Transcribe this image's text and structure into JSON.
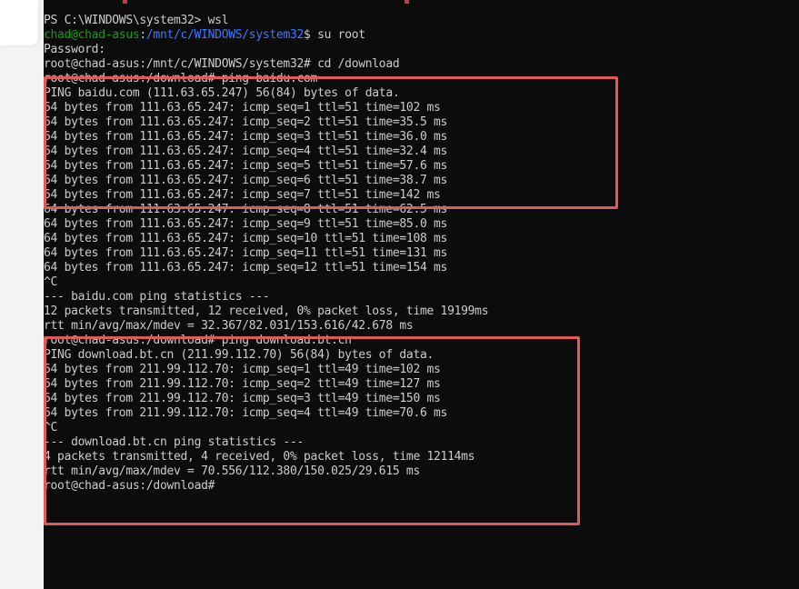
{
  "colors": {
    "background": "#0c0c0c",
    "text": "#cccccc",
    "user_host": "#13a10e",
    "path": "#3b78ff",
    "highlight": "#e05a5a",
    "side_panel": "#f3f3f3"
  },
  "terminal": {
    "lines": [
      {
        "segments": [
          {
            "text": "PS C:\\WINDOWS\\system32> wsl",
            "color": "default"
          }
        ]
      },
      {
        "segments": [
          {
            "text": "chad@chad-asus",
            "color": "green"
          },
          {
            "text": ":",
            "color": "default"
          },
          {
            "text": "/mnt/c/WINDOWS/system32",
            "color": "blue"
          },
          {
            "text": "$ su root",
            "color": "default"
          }
        ]
      },
      {
        "segments": [
          {
            "text": "Password:",
            "color": "default"
          }
        ]
      },
      {
        "segments": [
          {
            "text": "root@chad-asus:/mnt/c/WINDOWS/system32# cd /download",
            "color": "default"
          }
        ]
      },
      {
        "segments": [
          {
            "text": "root@chad-asus:/download# ping baidu.com",
            "color": "default"
          }
        ]
      },
      {
        "segments": [
          {
            "text": "PING baidu.com (111.63.65.247) 56(84) bytes of data.",
            "color": "default"
          }
        ]
      },
      {
        "segments": [
          {
            "text": "64 bytes from 111.63.65.247: icmp_seq=1 ttl=51 time=102 ms",
            "color": "default"
          }
        ]
      },
      {
        "segments": [
          {
            "text": "64 bytes from 111.63.65.247: icmp_seq=2 ttl=51 time=35.5 ms",
            "color": "default"
          }
        ]
      },
      {
        "segments": [
          {
            "text": "64 bytes from 111.63.65.247: icmp_seq=3 ttl=51 time=36.0 ms",
            "color": "default"
          }
        ]
      },
      {
        "segments": [
          {
            "text": "64 bytes from 111.63.65.247: icmp_seq=4 ttl=51 time=32.4 ms",
            "color": "default"
          }
        ]
      },
      {
        "segments": [
          {
            "text": "64 bytes from 111.63.65.247: icmp_seq=5 ttl=51 time=57.6 ms",
            "color": "default"
          }
        ]
      },
      {
        "segments": [
          {
            "text": "64 bytes from 111.63.65.247: icmp_seq=6 ttl=51 time=38.7 ms",
            "color": "default"
          }
        ]
      },
      {
        "segments": [
          {
            "text": "64 bytes from 111.63.65.247: icmp_seq=7 ttl=51 time=142 ms",
            "color": "default"
          }
        ]
      },
      {
        "segments": [
          {
            "text": "64 bytes from 111.63.65.247: icmp_seq=8 ttl=51 time=62.5 ms",
            "color": "default"
          }
        ]
      },
      {
        "segments": [
          {
            "text": "64 bytes from 111.63.65.247: icmp_seq=9 ttl=51 time=85.0 ms",
            "color": "default"
          }
        ]
      },
      {
        "segments": [
          {
            "text": "64 bytes from 111.63.65.247: icmp_seq=10 ttl=51 time=108 ms",
            "color": "default"
          }
        ]
      },
      {
        "segments": [
          {
            "text": "64 bytes from 111.63.65.247: icmp_seq=11 ttl=51 time=131 ms",
            "color": "default"
          }
        ]
      },
      {
        "segments": [
          {
            "text": "64 bytes from 111.63.65.247: icmp_seq=12 ttl=51 time=154 ms",
            "color": "default"
          }
        ]
      },
      {
        "segments": [
          {
            "text": "^C",
            "color": "default"
          }
        ]
      },
      {
        "segments": [
          {
            "text": "--- baidu.com ping statistics ---",
            "color": "default"
          }
        ]
      },
      {
        "segments": [
          {
            "text": "12 packets transmitted, 12 received, 0% packet loss, time 19199ms",
            "color": "default"
          }
        ]
      },
      {
        "segments": [
          {
            "text": "rtt min/avg/max/mdev = 32.367/82.031/153.616/42.678 ms",
            "color": "default"
          }
        ]
      },
      {
        "segments": [
          {
            "text": "root@chad-asus:/download# ping download.bt.cn",
            "color": "default"
          }
        ]
      },
      {
        "segments": [
          {
            "text": "PING download.bt.cn (211.99.112.70) 56(84) bytes of data.",
            "color": "default"
          }
        ]
      },
      {
        "segments": [
          {
            "text": "64 bytes from 211.99.112.70: icmp_seq=1 ttl=49 time=102 ms",
            "color": "default"
          }
        ]
      },
      {
        "segments": [
          {
            "text": "64 bytes from 211.99.112.70: icmp_seq=2 ttl=49 time=127 ms",
            "color": "default"
          }
        ]
      },
      {
        "segments": [
          {
            "text": "64 bytes from 211.99.112.70: icmp_seq=3 ttl=49 time=150 ms",
            "color": "default"
          }
        ]
      },
      {
        "segments": [
          {
            "text": "64 bytes from 211.99.112.70: icmp_seq=4 ttl=49 time=70.6 ms",
            "color": "default"
          }
        ]
      },
      {
        "segments": [
          {
            "text": "^C",
            "color": "default"
          }
        ]
      },
      {
        "segments": [
          {
            "text": "--- download.bt.cn ping statistics ---",
            "color": "default"
          }
        ]
      },
      {
        "segments": [
          {
            "text": "4 packets transmitted, 4 received, 0% packet loss, time 12114ms",
            "color": "default"
          }
        ]
      },
      {
        "segments": [
          {
            "text": "rtt min/avg/max/mdev = 70.556/112.380/150.025/29.615 ms",
            "color": "default"
          }
        ]
      },
      {
        "segments": [
          {
            "text": "root@chad-asus:/download#",
            "color": "default"
          }
        ]
      }
    ]
  }
}
